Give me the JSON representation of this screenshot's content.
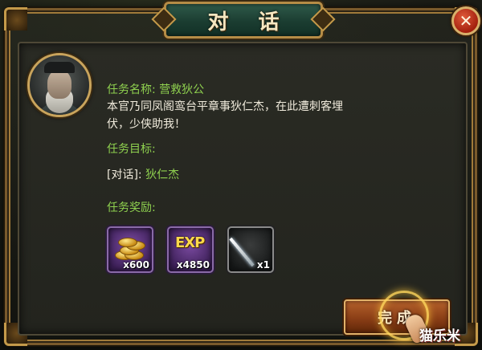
{
  "dialog": {
    "title": "对 话",
    "close_symbol": "✕"
  },
  "npc": {
    "avatar_icon": "elderly-official-portrait"
  },
  "task": {
    "name_label": "任务名称: ",
    "name_value": "营救狄公",
    "description_line1": "本官乃同凤阁鸾台平章事狄仁杰，在此遭刺客埋",
    "description_line2": "伏，少侠助我！",
    "goal_label": "任务目标:",
    "goal_prefix": "[对话]: ",
    "goal_target": "狄仁杰",
    "reward_label": "任务奖励:",
    "rewards": [
      {
        "icon": "gold-coins-icon",
        "quantity": "x600"
      },
      {
        "icon": "exp-icon",
        "badge": "EXP",
        "quantity": "x4850"
      },
      {
        "icon": "sword-icon",
        "quantity": "x1"
      }
    ]
  },
  "actions": {
    "complete_label": "完成"
  },
  "watermark": "猫乐米",
  "colors": {
    "highlight_green": "#8fd14f",
    "body_text": "#f0ebdc",
    "frame_gold": "#b58c46",
    "title_plate_green": "#1b3d31"
  }
}
